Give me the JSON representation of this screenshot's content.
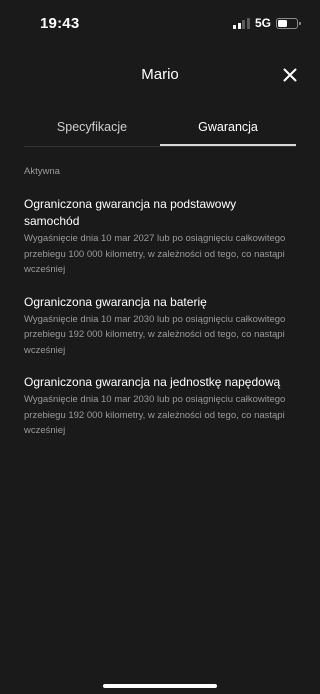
{
  "status_bar": {
    "time": "19:43",
    "network": "5G"
  },
  "header": {
    "title": "Mario",
    "close_icon": "close-icon"
  },
  "tabs": [
    {
      "label": "Specyfikacje",
      "active": false
    },
    {
      "label": "Gwarancja",
      "active": true
    }
  ],
  "section": {
    "label": "Aktywna"
  },
  "warranties": [
    {
      "title": "Ograniczona gwarancja na podstawowy samochód",
      "description": "Wygaśnięcie dnia 10 mar 2027 lub po osiągnięciu całkowitego przebiegu 100 000 kilometry, w zależności od tego, co nastąpi wcześniej"
    },
    {
      "title": "Ograniczona gwarancja na baterię",
      "description": "Wygaśnięcie dnia 10 mar 2030 lub po osiągnięciu całkowitego przebiegu 192 000 kilometry, w zależności od tego, co nastąpi wcześniej"
    },
    {
      "title": "Ograniczona gwarancja na jednostkę napędową",
      "description": "Wygaśnięcie dnia 10 mar 2030 lub po osiągnięciu całkowitego przebiegu 192 000 kilometry, w zależności od tego, co nastąpi wcześniej"
    }
  ],
  "colors": {
    "background": "#1a1a1a",
    "text_primary": "#ffffff",
    "text_secondary": "#9a9a9a"
  }
}
